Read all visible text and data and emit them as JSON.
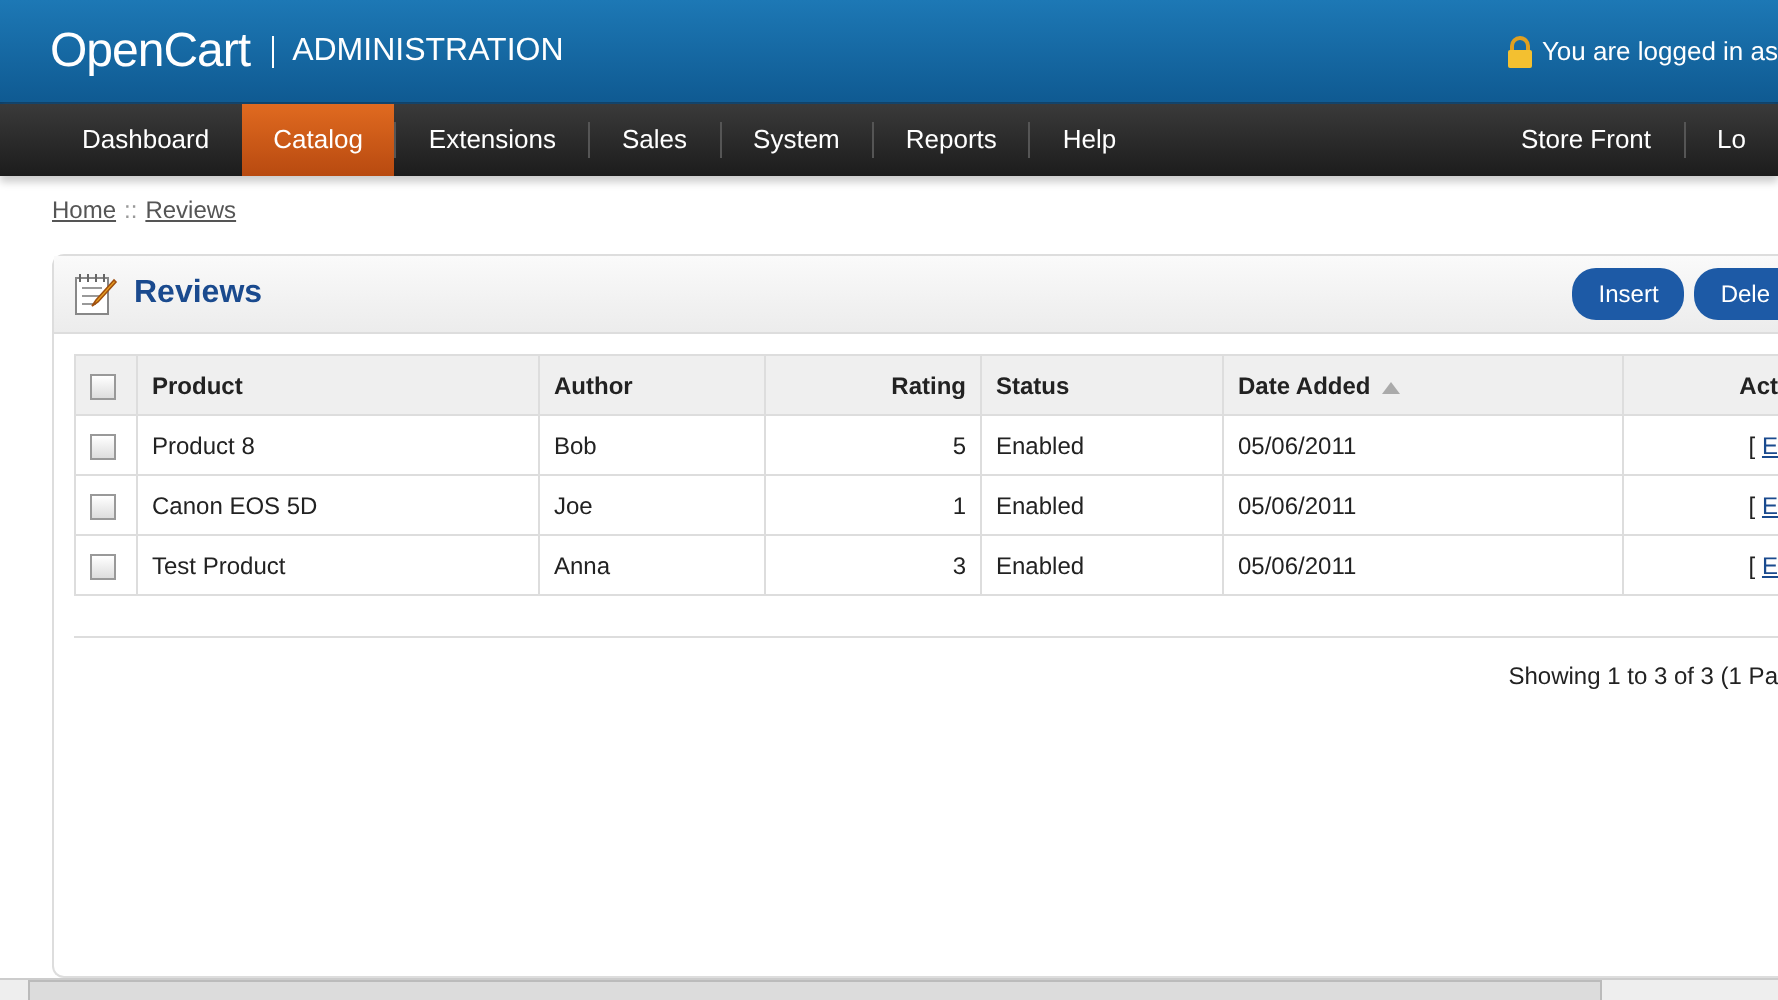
{
  "header": {
    "logo": "OpenCart",
    "subtitle": "ADMINISTRATION",
    "login_text": "You are logged in as"
  },
  "nav": {
    "items": [
      {
        "label": "Dashboard",
        "selected": false
      },
      {
        "label": "Catalog",
        "selected": true
      },
      {
        "label": "Extensions",
        "selected": false
      },
      {
        "label": "Sales",
        "selected": false
      },
      {
        "label": "System",
        "selected": false
      },
      {
        "label": "Reports",
        "selected": false
      },
      {
        "label": "Help",
        "selected": false
      }
    ],
    "right_items": [
      "Store Front",
      "Lo"
    ]
  },
  "breadcrumb": {
    "items": [
      "Home",
      "Reviews"
    ],
    "separator": "::"
  },
  "panel": {
    "title": "Reviews",
    "buttons": [
      "Insert",
      "Dele"
    ]
  },
  "table": {
    "select_all_checked": false,
    "columns": [
      "Product",
      "Author",
      "Rating",
      "Status",
      "Date Added",
      "Act"
    ],
    "rows": [
      {
        "checked": false,
        "product": "Product 8",
        "author": "Bob",
        "rating": "5",
        "status": "Enabled",
        "date_added": "05/06/2011",
        "action_open": "[",
        "action_link": "E"
      },
      {
        "checked": false,
        "product": "Canon EOS 5D",
        "author": "Joe",
        "rating": "1",
        "status": "Enabled",
        "date_added": "05/06/2011",
        "action_open": "[",
        "action_link": "E"
      },
      {
        "checked": false,
        "product": "Test Product",
        "author": "Anna",
        "rating": "3",
        "status": "Enabled",
        "date_added": "05/06/2011",
        "action_open": "[",
        "action_link": "E"
      }
    ]
  },
  "pagination": {
    "text": "Showing 1 to 3 of 3 (1 Pa"
  }
}
